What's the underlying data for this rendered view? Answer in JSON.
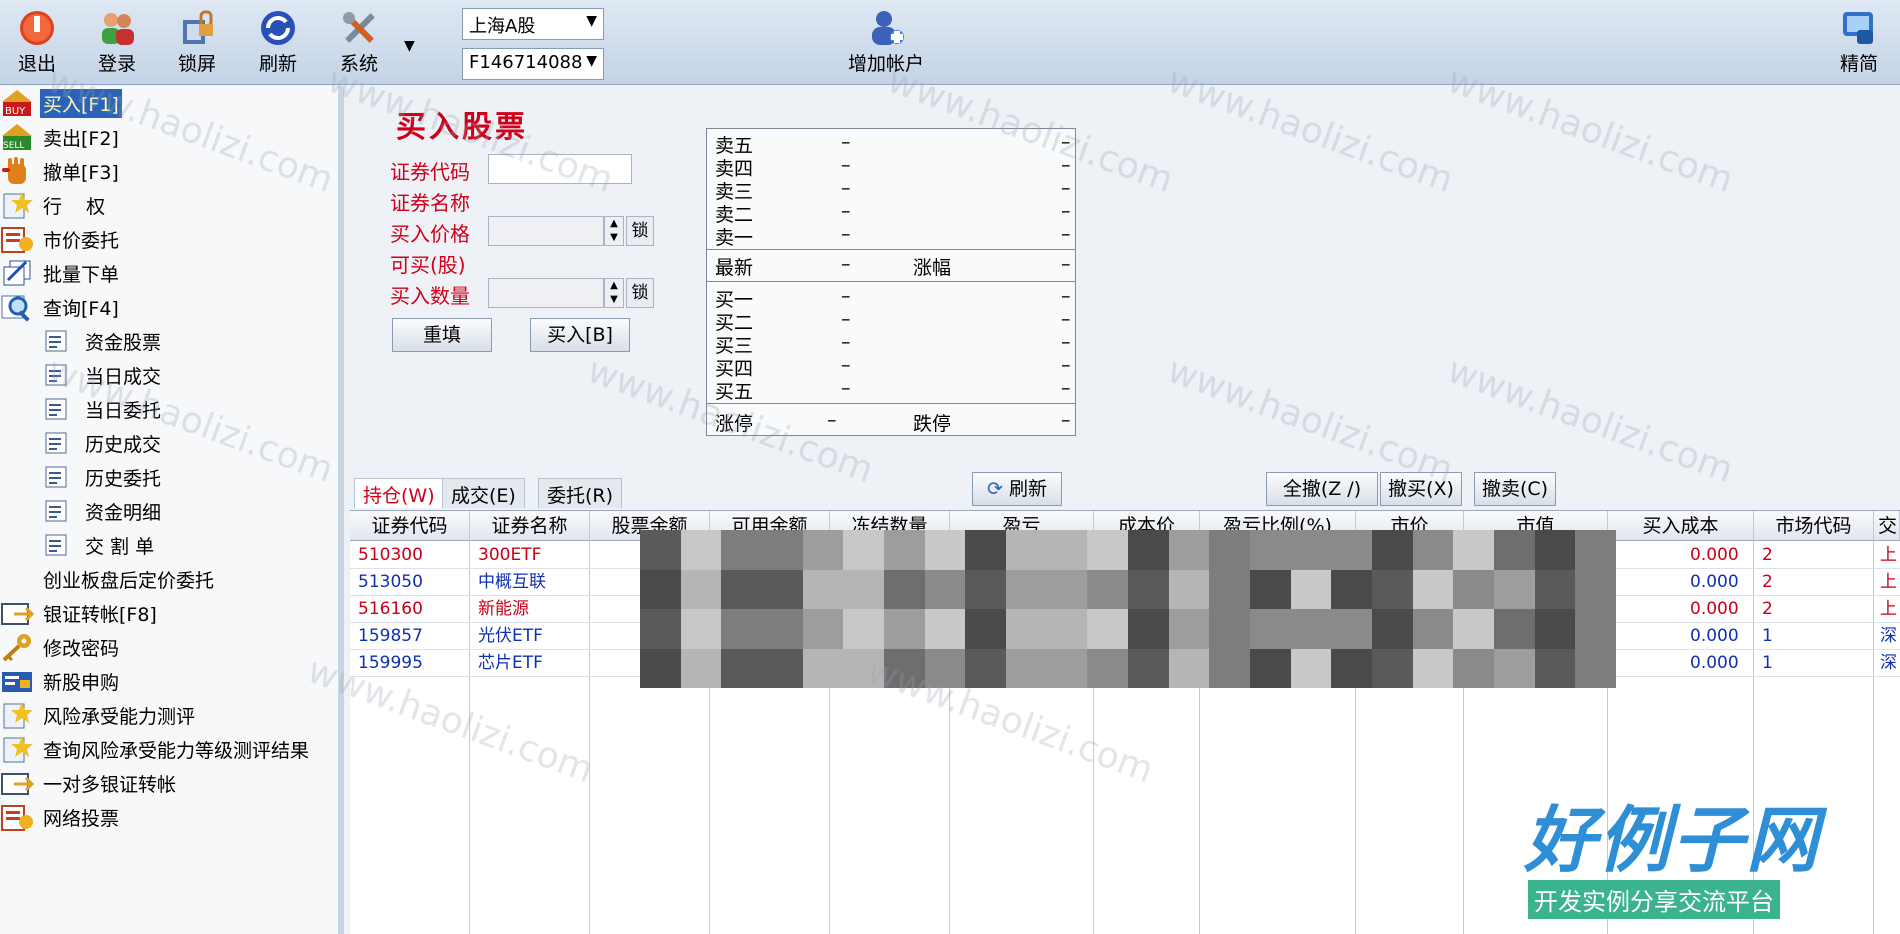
{
  "toolbar": {
    "buttons": [
      {
        "label": "退出",
        "icon": "power-icon"
      },
      {
        "label": "登录",
        "icon": "users-icon"
      },
      {
        "label": "锁屏",
        "icon": "lock-icon"
      },
      {
        "label": "刷新",
        "icon": "refresh-icon"
      },
      {
        "label": "系统",
        "icon": "tools-icon"
      }
    ],
    "market_select": "上海A股",
    "account_select": "F146714088",
    "add_account": "增加帐户",
    "compact": "精简"
  },
  "sidebar": {
    "items": [
      {
        "label": "买入[F1]",
        "icon": "buy-icon",
        "active": true
      },
      {
        "label": "卖出[F2]",
        "icon": "sell-icon"
      },
      {
        "label": "撤单[F3]",
        "icon": "hand-icon"
      },
      {
        "label": "行    权",
        "icon": "exercise-icon"
      },
      {
        "label": "市价委托",
        "icon": "market-order-icon"
      },
      {
        "label": "批量下单",
        "icon": "batch-icon"
      },
      {
        "label": "查询[F4]",
        "icon": "magnifier-icon"
      }
    ],
    "sub_items": [
      "资金股票",
      "当日成交",
      "当日委托",
      "历史成交",
      "历史委托",
      "资金明细",
      "交 割 单"
    ],
    "plain_item": "创业板盘后定价委托",
    "items2": [
      {
        "label": "银证转帐[F8]",
        "icon": "transfer-icon"
      },
      {
        "label": "修改密码",
        "icon": "key-icon"
      },
      {
        "label": "新股申购",
        "icon": "ipo-icon"
      },
      {
        "label": "风险承受能力测评",
        "icon": "star-doc-icon"
      },
      {
        "label": "查询风险承受能力等级测评结果",
        "icon": "star-doc-icon"
      },
      {
        "label": "一对多银证转帐",
        "icon": "transfer-icon"
      },
      {
        "label": "网络投票",
        "icon": "vote-icon"
      }
    ]
  },
  "form": {
    "title": "买入股票",
    "code_label": "证券代码",
    "name_label": "证券名称",
    "price_label": "买入价格",
    "max_label": "可买(股)",
    "qty_label": "买入数量",
    "lock": "锁",
    "reset": "重填",
    "buy": "买入[B]"
  },
  "quote": {
    "sells": [
      "卖五",
      "卖四",
      "卖三",
      "卖二",
      "卖一"
    ],
    "buys": [
      "买一",
      "买二",
      "买三",
      "买四",
      "买五"
    ],
    "latest": "最新",
    "change": "涨幅",
    "limit_up": "涨停",
    "limit_down": "跌停",
    "dash": "–"
  },
  "tabs": [
    "持仓(W)",
    "成交(E)",
    "委托(R)"
  ],
  "actions": {
    "refresh": "刷新",
    "cancel_all": "全撤(Z /)",
    "cancel_buy": "撤买(X)",
    "cancel_sell": "撤卖(C)"
  },
  "table": {
    "headers": [
      "证券代码",
      "证券名称",
      "股票余额",
      "可用余额",
      "冻结数量",
      "盈亏",
      "成本价",
      "盈亏比例(%)",
      "市价",
      "市值",
      "买入成本",
      "市场代码",
      "交"
    ],
    "rows": [
      {
        "code": "510300",
        "name": "300ETF",
        "cost": "0.000",
        "market": "2",
        "ex": "上",
        "color": "#c8001a"
      },
      {
        "code": "513050",
        "name": "中概互联",
        "cost": "0.000",
        "market": "2",
        "ex": "上",
        "color": "#1030b0"
      },
      {
        "code": "516160",
        "name": "新能源",
        "cost": "0.000",
        "market": "2",
        "ex": "上",
        "color": "#c8001a"
      },
      {
        "code": "159857",
        "name": "光伏ETF",
        "cost": "0.000",
        "market": "1",
        "ex": "深",
        "color": "#1030b0"
      },
      {
        "code": "159995",
        "name": "芯片ETF",
        "cost": "0.000",
        "market": "1",
        "ex": "深",
        "color": "#1030b0"
      }
    ]
  },
  "logo": {
    "main": "好例子网",
    "sub": "开发实例分享交流平台"
  },
  "watermark": "www.haolizi.com"
}
